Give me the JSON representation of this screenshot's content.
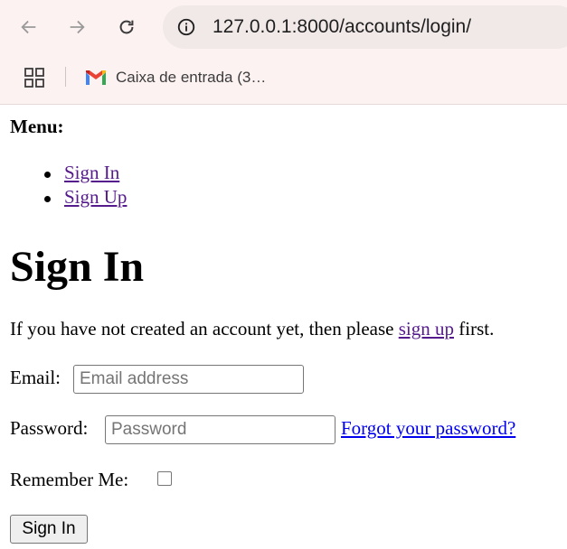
{
  "browser": {
    "url": "127.0.0.1:8000/accounts/login/",
    "bookmarks": [
      {
        "label": "Caixa de entrada (3…",
        "icon": "gmail-icon"
      }
    ]
  },
  "menu": {
    "title": "Menu:",
    "items": [
      {
        "label": "Sign In"
      },
      {
        "label": "Sign Up"
      }
    ]
  },
  "heading": "Sign In",
  "intro": {
    "before": "If you have not created an account yet, then please ",
    "link": "sign up",
    "after": " first."
  },
  "form": {
    "email_label": "Email:",
    "email_placeholder": "Email address",
    "email_value": "",
    "password_label": "Password:",
    "password_placeholder": "Password",
    "password_value": "",
    "forgot_link": "Forgot your password?",
    "remember_label": "Remember Me:",
    "remember_checked": false,
    "submit_label": "Sign In"
  },
  "colors": {
    "chrome_bg": "#fdf2f2",
    "visited_link": "#551a8b",
    "unvisited_link": "#0000ee"
  }
}
